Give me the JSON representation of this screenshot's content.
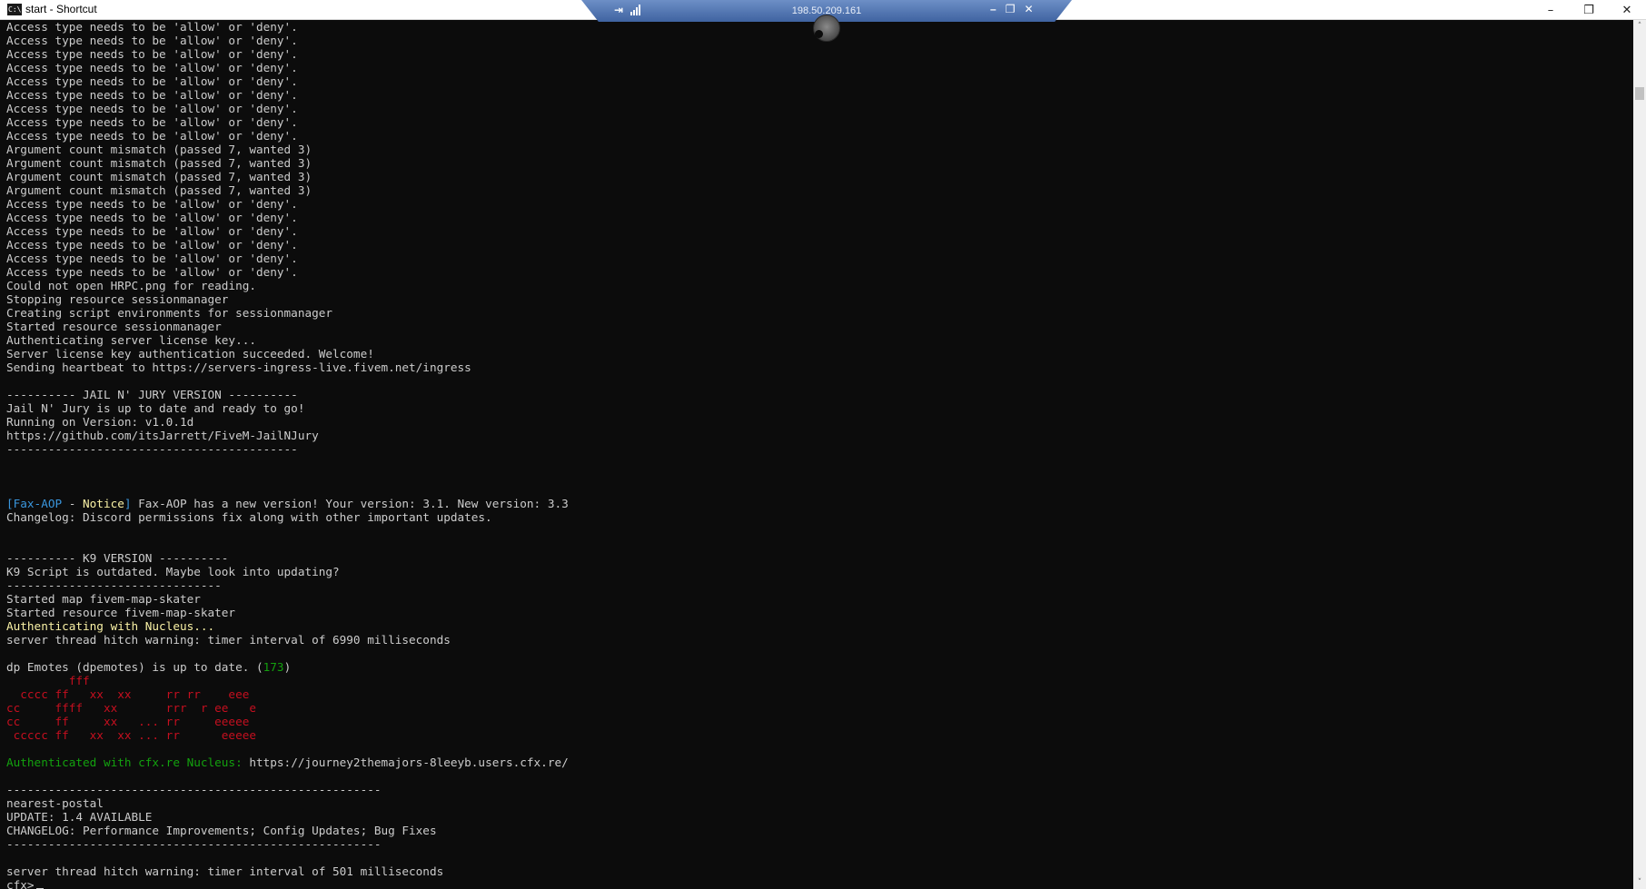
{
  "window": {
    "title": "start - Shortcut",
    "app_icon": "C:\\",
    "minimize_glyph": "–",
    "restore_glyph": "❐",
    "close_glyph": "✕"
  },
  "rdp_bar": {
    "ip": "198.50.209.161",
    "pin_glyph": "⇥",
    "minimize_glyph": "–",
    "restore_glyph": "❐",
    "close_glyph": "✕"
  },
  "colors": {
    "background": "#0c0c0c",
    "default_text": "#cccccc",
    "blue": "#3a96dd",
    "yellow": "#f9f1a5",
    "green": "#13a10e",
    "red": "#c50f1f"
  },
  "console": {
    "lines": [
      [
        {
          "t": "Access type needs to be 'allow' or 'deny'.",
          "c": "def"
        }
      ],
      [
        {
          "t": "Access type needs to be 'allow' or 'deny'.",
          "c": "def"
        }
      ],
      [
        {
          "t": "Access type needs to be 'allow' or 'deny'.",
          "c": "def"
        }
      ],
      [
        {
          "t": "Access type needs to be 'allow' or 'deny'.",
          "c": "def"
        }
      ],
      [
        {
          "t": "Access type needs to be 'allow' or 'deny'.",
          "c": "def"
        }
      ],
      [
        {
          "t": "Access type needs to be 'allow' or 'deny'.",
          "c": "def"
        }
      ],
      [
        {
          "t": "Access type needs to be 'allow' or 'deny'.",
          "c": "def"
        }
      ],
      [
        {
          "t": "Access type needs to be 'allow' or 'deny'.",
          "c": "def"
        }
      ],
      [
        {
          "t": "Access type needs to be 'allow' or 'deny'.",
          "c": "def"
        }
      ],
      [
        {
          "t": "Argument count mismatch (passed 7, wanted 3)",
          "c": "def"
        }
      ],
      [
        {
          "t": "Argument count mismatch (passed 7, wanted 3)",
          "c": "def"
        }
      ],
      [
        {
          "t": "Argument count mismatch (passed 7, wanted 3)",
          "c": "def"
        }
      ],
      [
        {
          "t": "Argument count mismatch (passed 7, wanted 3)",
          "c": "def"
        }
      ],
      [
        {
          "t": "Access type needs to be 'allow' or 'deny'.",
          "c": "def"
        }
      ],
      [
        {
          "t": "Access type needs to be 'allow' or 'deny'.",
          "c": "def"
        }
      ],
      [
        {
          "t": "Access type needs to be 'allow' or 'deny'.",
          "c": "def"
        }
      ],
      [
        {
          "t": "Access type needs to be 'allow' or 'deny'.",
          "c": "def"
        }
      ],
      [
        {
          "t": "Access type needs to be 'allow' or 'deny'.",
          "c": "def"
        }
      ],
      [
        {
          "t": "Access type needs to be 'allow' or 'deny'.",
          "c": "def"
        }
      ],
      [
        {
          "t": "Could not open HRPC.png for reading.",
          "c": "def"
        }
      ],
      [
        {
          "t": "Stopping resource sessionmanager",
          "c": "def"
        }
      ],
      [
        {
          "t": "Creating script environments for sessionmanager",
          "c": "def"
        }
      ],
      [
        {
          "t": "Started resource sessionmanager",
          "c": "def"
        }
      ],
      [
        {
          "t": "Authenticating server license key...",
          "c": "def"
        }
      ],
      [
        {
          "t": "Server license key authentication succeeded. Welcome!",
          "c": "def"
        }
      ],
      [
        {
          "t": "Sending heartbeat to https://servers-ingress-live.fivem.net/ingress",
          "c": "def"
        }
      ],
      [],
      [
        {
          "t": "---------- JAIL N' JURY VERSION ----------",
          "c": "def"
        }
      ],
      [
        {
          "t": "Jail N' Jury is up to date and ready to go!",
          "c": "def"
        }
      ],
      [
        {
          "t": "Running on Version: v1.0.1d",
          "c": "def"
        }
      ],
      [
        {
          "t": "https://github.com/itsJarrett/FiveM-JailNJury",
          "c": "def"
        }
      ],
      [
        {
          "t": "------------------------------------------",
          "c": "def"
        }
      ],
      [],
      [],
      [],
      [
        {
          "t": "[Fax-AOP",
          "c": "blue"
        },
        {
          "t": " - ",
          "c": "def"
        },
        {
          "t": "Notice",
          "c": "yellow"
        },
        {
          "t": "]",
          "c": "blue"
        },
        {
          "t": " Fax-AOP has a new version! Your version: 3.1. New version: 3.3",
          "c": "def"
        }
      ],
      [
        {
          "t": "Changelog: Discord permissions fix along with other important updates.",
          "c": "def"
        }
      ],
      [],
      [],
      [
        {
          "t": "---------- K9 VERSION ----------",
          "c": "def"
        }
      ],
      [
        {
          "t": "K9 Script is outdated. Maybe look into updating?",
          "c": "def"
        }
      ],
      [
        {
          "t": "-------------------------------",
          "c": "def"
        }
      ],
      [
        {
          "t": "Started map fivem-map-skater",
          "c": "def"
        }
      ],
      [
        {
          "t": "Started resource fivem-map-skater",
          "c": "def"
        }
      ],
      [
        {
          "t": "Authenticating with Nucleus...",
          "c": "yellow"
        }
      ],
      [
        {
          "t": "server thread hitch warning: timer interval of 6990 milliseconds",
          "c": "def"
        }
      ],
      [],
      [
        {
          "t": "dp Emotes (dpemotes) is up to date. (",
          "c": "def"
        },
        {
          "t": "173",
          "c": "green"
        },
        {
          "t": ")",
          "c": "def"
        }
      ],
      [
        {
          "t": "         fff",
          "c": "red"
        }
      ],
      [
        {
          "t": "  cccc ff   xx  xx     rr rr    eee",
          "c": "red"
        }
      ],
      [
        {
          "t": "cc     ffff   xx       rrr  r ee   e",
          "c": "red"
        }
      ],
      [
        {
          "t": "cc     ff     xx   ... rr     eeeee",
          "c": "red"
        }
      ],
      [
        {
          "t": " ccccc ff   xx  xx ... rr      eeeee",
          "c": "red"
        }
      ],
      [],
      [
        {
          "t": "Authenticated with cfx.re Nucleus: ",
          "c": "green"
        },
        {
          "t": "https://journey2themajors-8leeyb.users.cfx.re/",
          "c": "def"
        }
      ],
      [],
      [
        {
          "t": "------------------------------------------------------",
          "c": "def"
        }
      ],
      [
        {
          "t": "nearest-postal",
          "c": "def"
        }
      ],
      [
        {
          "t": "UPDATE: 1.4 AVAILABLE",
          "c": "def"
        }
      ],
      [
        {
          "t": "CHANGELOG: Performance Improvements; Config Updates; Bug Fixes",
          "c": "def"
        }
      ],
      [
        {
          "t": "------------------------------------------------------",
          "c": "def"
        }
      ],
      [],
      [
        {
          "t": "server thread hitch warning: timer interval of 501 milliseconds",
          "c": "def"
        }
      ]
    ],
    "prompt": "cfx>"
  },
  "scrollbar": {
    "up_glyph": "˄",
    "down_glyph": "˅"
  }
}
